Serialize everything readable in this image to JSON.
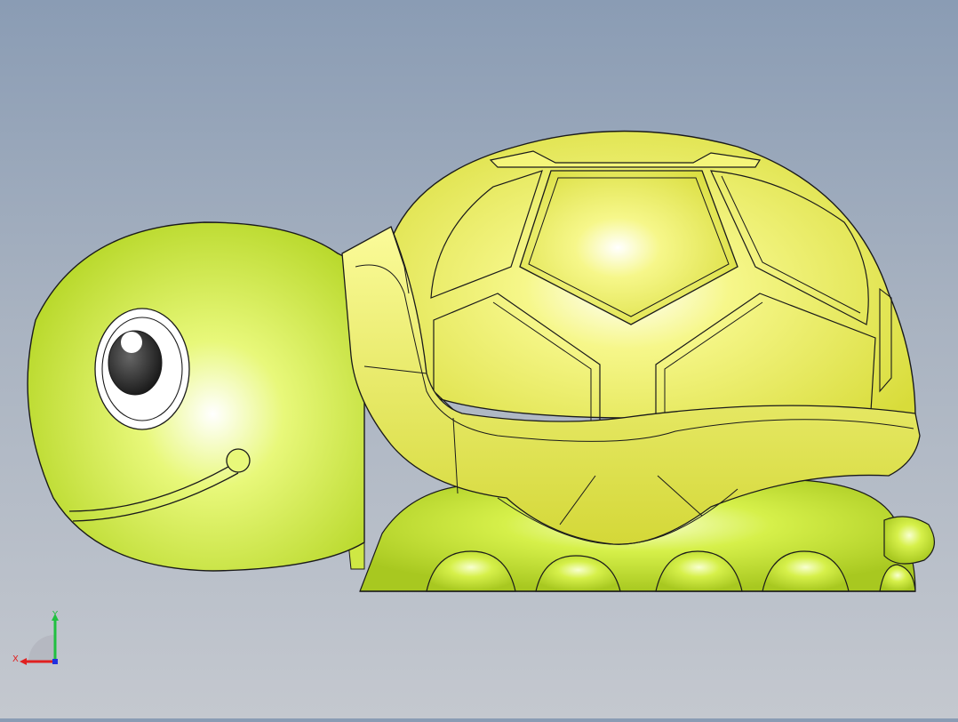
{
  "viewport": {
    "background_top": "#8a9cb4",
    "background_bottom": "#c4c8cf",
    "model": {
      "subject": "turtle",
      "body_color": "#d6f04a",
      "shell_color": "#f2f35a",
      "edge_color": "#1a1a1a"
    }
  },
  "triad": {
    "x_label": "X",
    "y_label": "Y",
    "x_color": "#e02020",
    "y_color": "#20c040",
    "z_color": "#2030e0"
  }
}
